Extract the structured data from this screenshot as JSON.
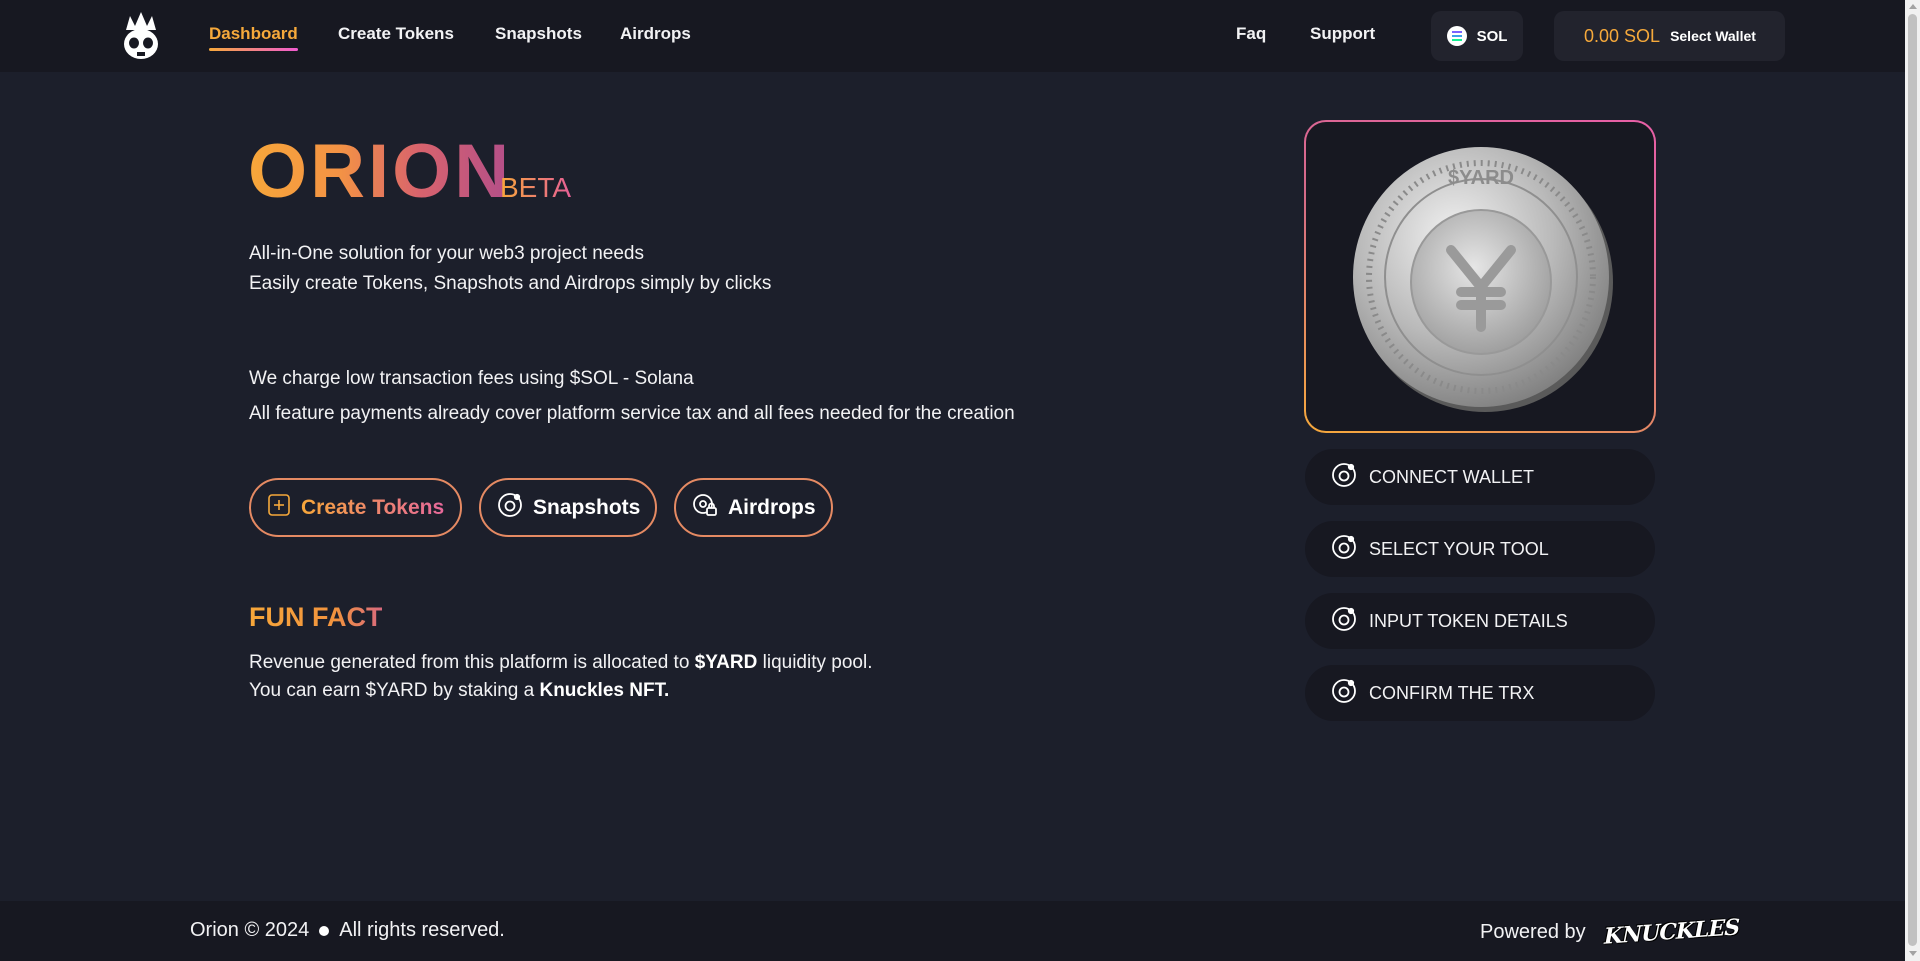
{
  "nav": {
    "items": [
      {
        "label": "Dashboard",
        "active": true
      },
      {
        "label": "Create Tokens"
      },
      {
        "label": "Snapshots"
      },
      {
        "label": "Airdrops"
      }
    ],
    "faq": "Faq",
    "support": "Support",
    "network": "SOL",
    "wallet_balance": "0.00 SOL",
    "wallet_label": "Select Wallet"
  },
  "hero": {
    "title": "ORION",
    "badge": "BETA",
    "line1": "All-in-One solution for your web3 project needs",
    "line2": "Easily create Tokens, Snapshots and Airdrops simply by clicks",
    "fee1": "We charge low transaction fees using $SOL - Solana",
    "fee2": "All feature payments already cover platform service tax and all fees needed for the creation"
  },
  "actions": {
    "create": "Create Tokens",
    "snapshots": "Snapshots",
    "airdrops": "Airdrops"
  },
  "fun_fact": {
    "title": "FUN FACT",
    "line1_a": "Revenue generated from this platform is allocated to ",
    "line1_b": "$YARD",
    "line1_c": " liquidity pool.",
    "line2_a": "You can earn $YARD by staking a ",
    "line2_b": "Knuckles NFT."
  },
  "coin_text": "$YARD",
  "steps": [
    "CONNECT WALLET",
    "SELECT YOUR TOOL",
    "INPUT TOKEN DETAILS",
    "CONFIRM THE TRX"
  ],
  "footer": {
    "copyright": "Orion © 2024",
    "rights": "All rights reserved.",
    "powered": "Powered by",
    "brand": "KNUCKLES"
  },
  "colors": {
    "accent_orange": "#f6a93b",
    "accent_pink": "#e85fa7",
    "background": "#1c1f2b"
  }
}
